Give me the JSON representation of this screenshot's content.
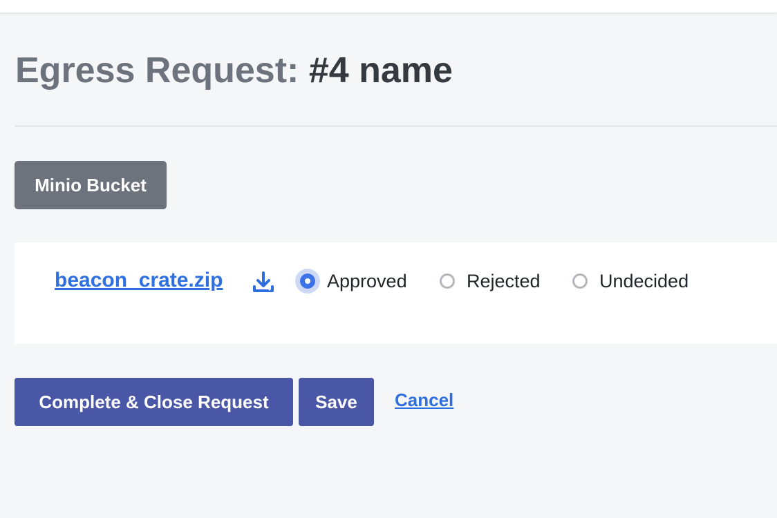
{
  "header": {
    "title_prefix": "Egress Request:",
    "title_name": "#4 name"
  },
  "bucket_button": {
    "label": "Minio Bucket"
  },
  "files": [
    {
      "name": "beacon_crate.zip",
      "download_icon": "download-icon",
      "decision_options": [
        "Approved",
        "Rejected",
        "Undecided"
      ],
      "selected": "Approved"
    }
  ],
  "actions": {
    "complete_label": "Complete & Close Request",
    "save_label": "Save",
    "cancel_label": "Cancel"
  },
  "colors": {
    "background": "#f5f6f8",
    "primary": "#4a56a6",
    "secondary": "#6c737c",
    "link": "#2f6fe0",
    "radio_checked": "#3d73e6"
  }
}
